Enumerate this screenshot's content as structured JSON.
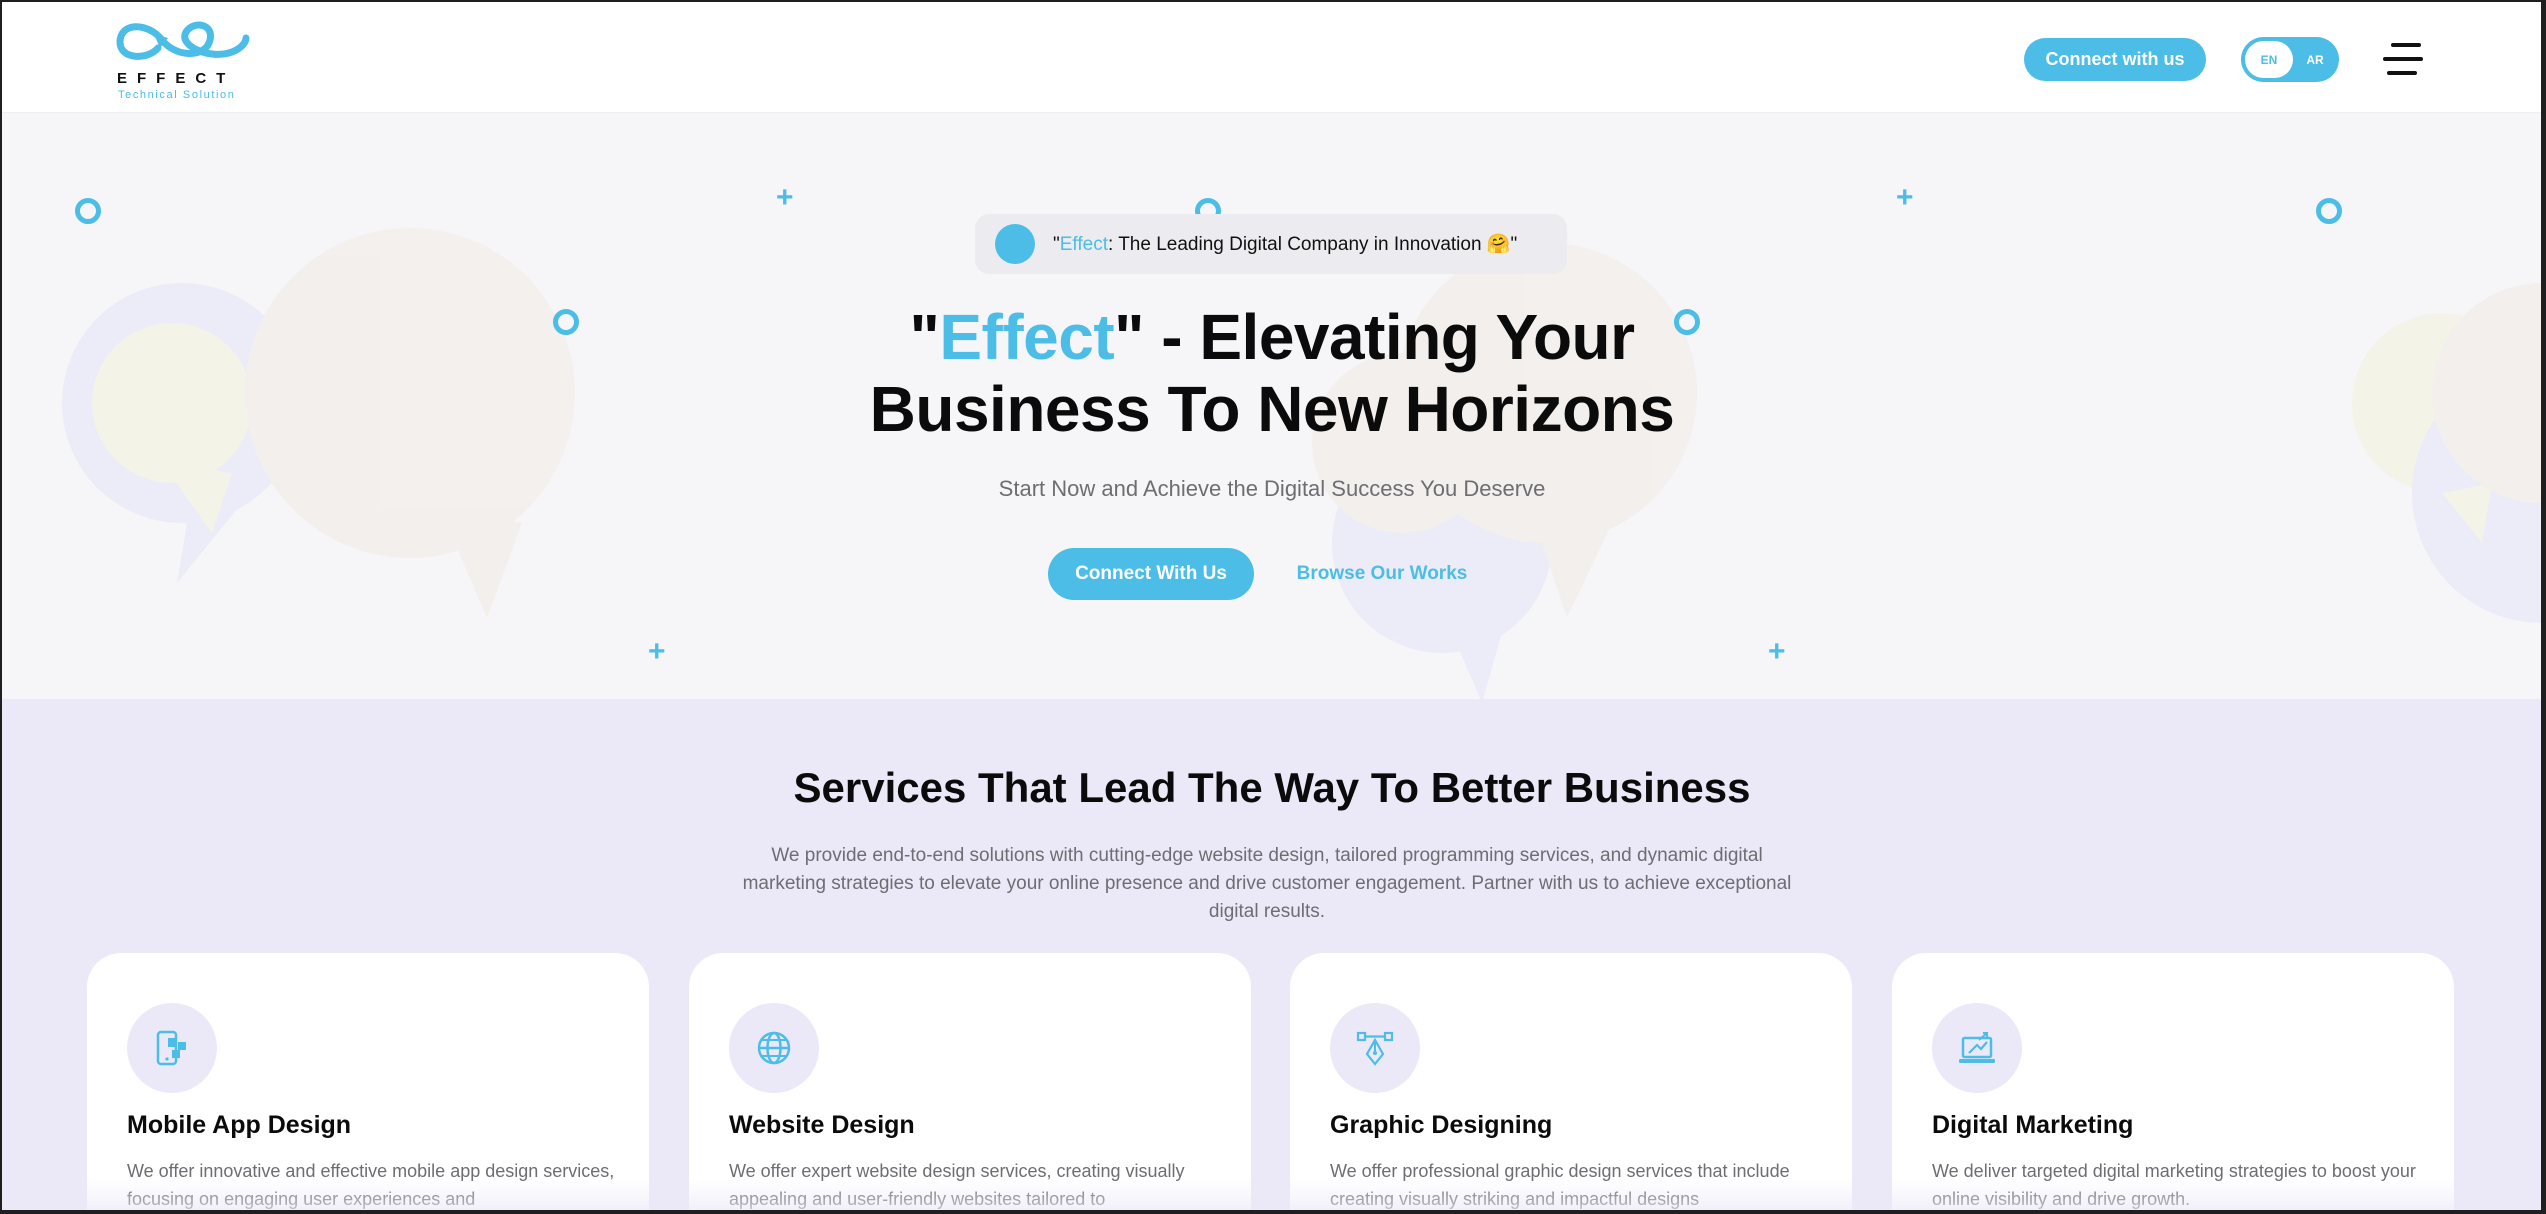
{
  "header": {
    "logo_word": "EFFECT",
    "logo_sub": "Technical Solution",
    "connect_label": "Connect with us",
    "lang_en": "EN",
    "lang_ar": "AR"
  },
  "hero": {
    "pill": {
      "quote_open": "\"",
      "brand": "Effect",
      "rest": ": The Leading Digital Company in Innovation 🤗\""
    },
    "title": {
      "quote_open": "\"",
      "brand": "Effect",
      "line1_rest": "\" - Elevating Your",
      "line2": "Business To New Horizons"
    },
    "subtitle": "Start Now and Achieve the Digital Success You Deserve",
    "primary_button": "Connect With Us",
    "secondary_button": "Browse Our Works"
  },
  "services": {
    "title": "Services That Lead The Way To Better Business",
    "description": "We provide end-to-end solutions with cutting-edge website design, tailored programming services, and dynamic digital marketing strategies to elevate your online presence and drive customer engagement. Partner with us to achieve exceptional digital results.",
    "cards": [
      {
        "icon": "mobile-app-icon",
        "title": "Mobile App Design",
        "description": "We offer innovative and effective mobile app design services, focusing on engaging user experiences and"
      },
      {
        "icon": "globe-icon",
        "title": "Website Design",
        "description": "We offer expert website design services, creating visually appealing and user-friendly websites tailored to"
      },
      {
        "icon": "pen-tool-icon",
        "title": "Graphic Designing",
        "description": "We offer professional graphic design services that include creating visually striking and impactful designs"
      },
      {
        "icon": "laptop-marketing-icon",
        "title": "Digital Marketing",
        "description": "We deliver targeted digital marketing strategies to boost your online visibility and drive growth."
      }
    ]
  },
  "colors": {
    "accent": "#4bbde6",
    "hero_bg": "#f6f6f8",
    "services_bg": "#ebe9f8",
    "text_dark": "#0b0b0b",
    "text_muted": "#6d6d72"
  }
}
